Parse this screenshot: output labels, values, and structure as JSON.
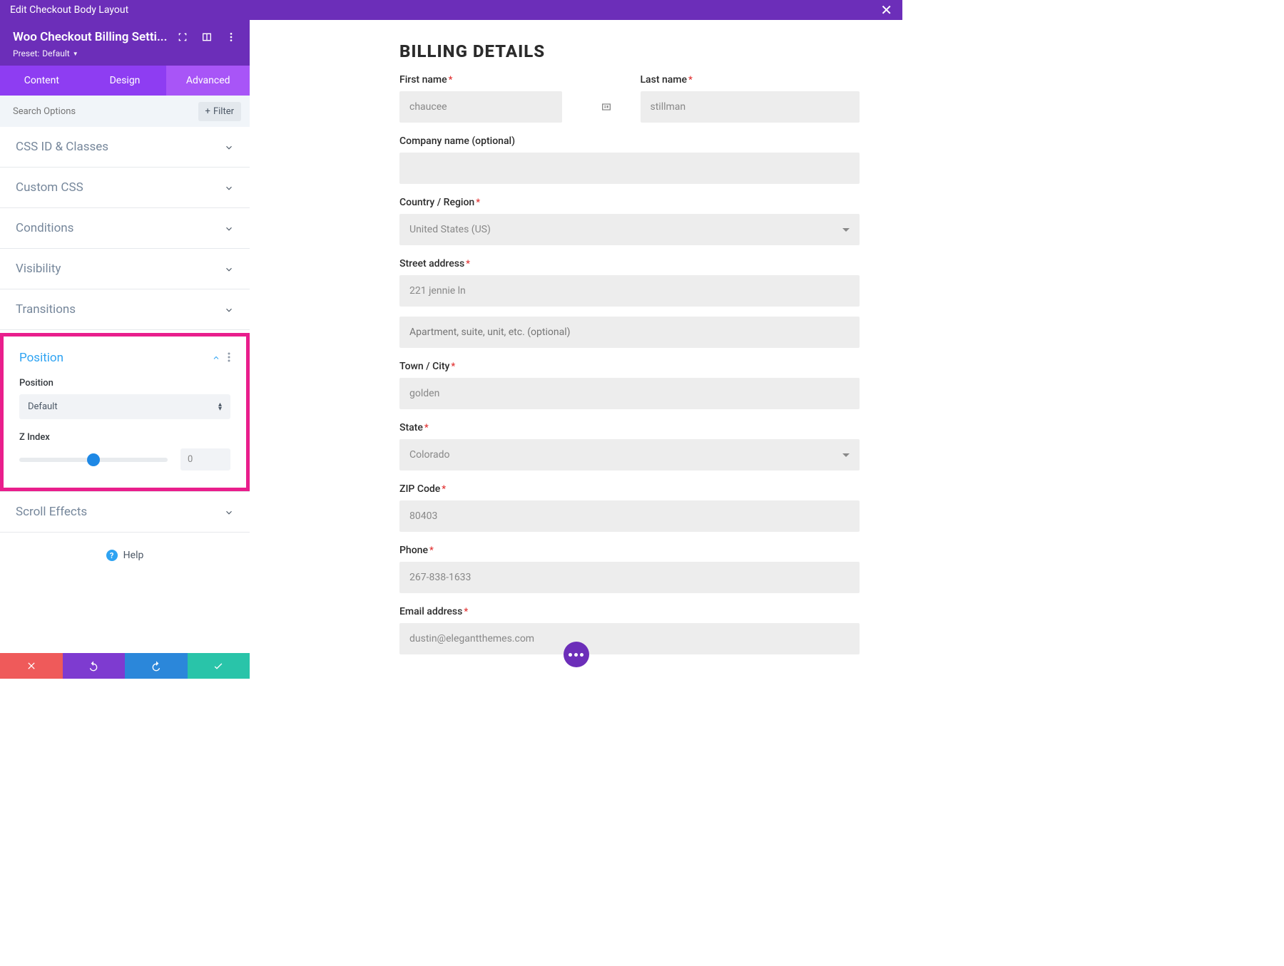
{
  "top_bar": {
    "title": "Edit Checkout Body Layout"
  },
  "module": {
    "title": "Woo Checkout Billing Setti...",
    "preset_label": "Preset:",
    "preset_value": "Default"
  },
  "tabs": {
    "content": "Content",
    "design": "Design",
    "advanced": "Advanced"
  },
  "search": {
    "placeholder": "Search Options",
    "filter": "Filter"
  },
  "accordion": {
    "css_id": "CSS ID & Classes",
    "custom_css": "Custom CSS",
    "conditions": "Conditions",
    "visibility": "Visibility",
    "transitions": "Transitions",
    "position": "Position",
    "scroll_effects": "Scroll Effects"
  },
  "position_panel": {
    "position_label": "Position",
    "position_value": "Default",
    "zindex_label": "Z Index",
    "zindex_value": "0"
  },
  "help": "Help",
  "billing": {
    "heading": "BILLING DETAILS",
    "first_name_label": "First name",
    "first_name_value": "chaucee",
    "last_name_label": "Last name",
    "last_name_value": "stillman",
    "company_label": "Company name (optional)",
    "company_value": "",
    "country_label": "Country / Region",
    "country_value": "United States (US)",
    "street_label": "Street address",
    "street_value": "221 jennie ln",
    "street2_placeholder": "Apartment, suite, unit, etc. (optional)",
    "city_label": "Town / City",
    "city_value": "golden",
    "state_label": "State",
    "state_value": "Colorado",
    "zip_label": "ZIP Code",
    "zip_value": "80403",
    "phone_label": "Phone",
    "phone_value": "267-838-1633",
    "email_label": "Email address",
    "email_value": "dustin@elegantthemes.com"
  }
}
